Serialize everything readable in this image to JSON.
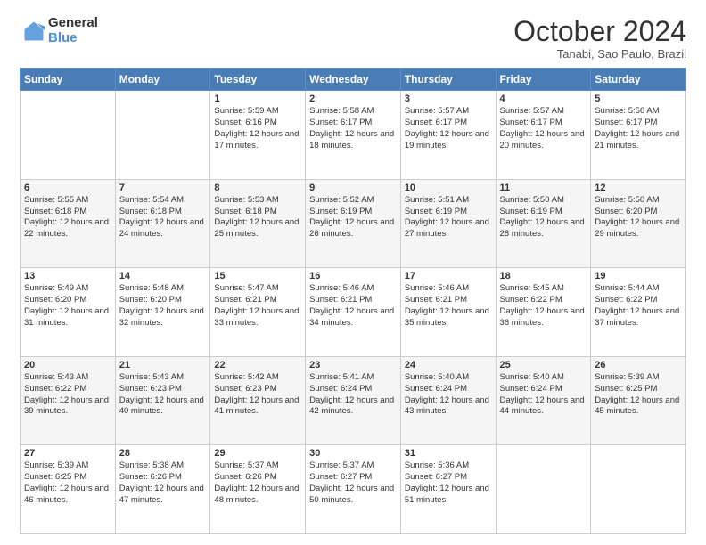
{
  "logo": {
    "general": "General",
    "blue": "Blue"
  },
  "header": {
    "month": "October 2024",
    "location": "Tanabi, Sao Paulo, Brazil"
  },
  "days_of_week": [
    "Sunday",
    "Monday",
    "Tuesday",
    "Wednesday",
    "Thursday",
    "Friday",
    "Saturday"
  ],
  "weeks": [
    [
      {
        "day": "",
        "info": ""
      },
      {
        "day": "",
        "info": ""
      },
      {
        "day": "1",
        "info": "Sunrise: 5:59 AM\nSunset: 6:16 PM\nDaylight: 12 hours and 17 minutes."
      },
      {
        "day": "2",
        "info": "Sunrise: 5:58 AM\nSunset: 6:17 PM\nDaylight: 12 hours and 18 minutes."
      },
      {
        "day": "3",
        "info": "Sunrise: 5:57 AM\nSunset: 6:17 PM\nDaylight: 12 hours and 19 minutes."
      },
      {
        "day": "4",
        "info": "Sunrise: 5:57 AM\nSunset: 6:17 PM\nDaylight: 12 hours and 20 minutes."
      },
      {
        "day": "5",
        "info": "Sunrise: 5:56 AM\nSunset: 6:17 PM\nDaylight: 12 hours and 21 minutes."
      }
    ],
    [
      {
        "day": "6",
        "info": "Sunrise: 5:55 AM\nSunset: 6:18 PM\nDaylight: 12 hours and 22 minutes."
      },
      {
        "day": "7",
        "info": "Sunrise: 5:54 AM\nSunset: 6:18 PM\nDaylight: 12 hours and 24 minutes."
      },
      {
        "day": "8",
        "info": "Sunrise: 5:53 AM\nSunset: 6:18 PM\nDaylight: 12 hours and 25 minutes."
      },
      {
        "day": "9",
        "info": "Sunrise: 5:52 AM\nSunset: 6:19 PM\nDaylight: 12 hours and 26 minutes."
      },
      {
        "day": "10",
        "info": "Sunrise: 5:51 AM\nSunset: 6:19 PM\nDaylight: 12 hours and 27 minutes."
      },
      {
        "day": "11",
        "info": "Sunrise: 5:50 AM\nSunset: 6:19 PM\nDaylight: 12 hours and 28 minutes."
      },
      {
        "day": "12",
        "info": "Sunrise: 5:50 AM\nSunset: 6:20 PM\nDaylight: 12 hours and 29 minutes."
      }
    ],
    [
      {
        "day": "13",
        "info": "Sunrise: 5:49 AM\nSunset: 6:20 PM\nDaylight: 12 hours and 31 minutes."
      },
      {
        "day": "14",
        "info": "Sunrise: 5:48 AM\nSunset: 6:20 PM\nDaylight: 12 hours and 32 minutes."
      },
      {
        "day": "15",
        "info": "Sunrise: 5:47 AM\nSunset: 6:21 PM\nDaylight: 12 hours and 33 minutes."
      },
      {
        "day": "16",
        "info": "Sunrise: 5:46 AM\nSunset: 6:21 PM\nDaylight: 12 hours and 34 minutes."
      },
      {
        "day": "17",
        "info": "Sunrise: 5:46 AM\nSunset: 6:21 PM\nDaylight: 12 hours and 35 minutes."
      },
      {
        "day": "18",
        "info": "Sunrise: 5:45 AM\nSunset: 6:22 PM\nDaylight: 12 hours and 36 minutes."
      },
      {
        "day": "19",
        "info": "Sunrise: 5:44 AM\nSunset: 6:22 PM\nDaylight: 12 hours and 37 minutes."
      }
    ],
    [
      {
        "day": "20",
        "info": "Sunrise: 5:43 AM\nSunset: 6:22 PM\nDaylight: 12 hours and 39 minutes."
      },
      {
        "day": "21",
        "info": "Sunrise: 5:43 AM\nSunset: 6:23 PM\nDaylight: 12 hours and 40 minutes."
      },
      {
        "day": "22",
        "info": "Sunrise: 5:42 AM\nSunset: 6:23 PM\nDaylight: 12 hours and 41 minutes."
      },
      {
        "day": "23",
        "info": "Sunrise: 5:41 AM\nSunset: 6:24 PM\nDaylight: 12 hours and 42 minutes."
      },
      {
        "day": "24",
        "info": "Sunrise: 5:40 AM\nSunset: 6:24 PM\nDaylight: 12 hours and 43 minutes."
      },
      {
        "day": "25",
        "info": "Sunrise: 5:40 AM\nSunset: 6:24 PM\nDaylight: 12 hours and 44 minutes."
      },
      {
        "day": "26",
        "info": "Sunrise: 5:39 AM\nSunset: 6:25 PM\nDaylight: 12 hours and 45 minutes."
      }
    ],
    [
      {
        "day": "27",
        "info": "Sunrise: 5:39 AM\nSunset: 6:25 PM\nDaylight: 12 hours and 46 minutes."
      },
      {
        "day": "28",
        "info": "Sunrise: 5:38 AM\nSunset: 6:26 PM\nDaylight: 12 hours and 47 minutes."
      },
      {
        "day": "29",
        "info": "Sunrise: 5:37 AM\nSunset: 6:26 PM\nDaylight: 12 hours and 48 minutes."
      },
      {
        "day": "30",
        "info": "Sunrise: 5:37 AM\nSunset: 6:27 PM\nDaylight: 12 hours and 50 minutes."
      },
      {
        "day": "31",
        "info": "Sunrise: 5:36 AM\nSunset: 6:27 PM\nDaylight: 12 hours and 51 minutes."
      },
      {
        "day": "",
        "info": ""
      },
      {
        "day": "",
        "info": ""
      }
    ]
  ]
}
